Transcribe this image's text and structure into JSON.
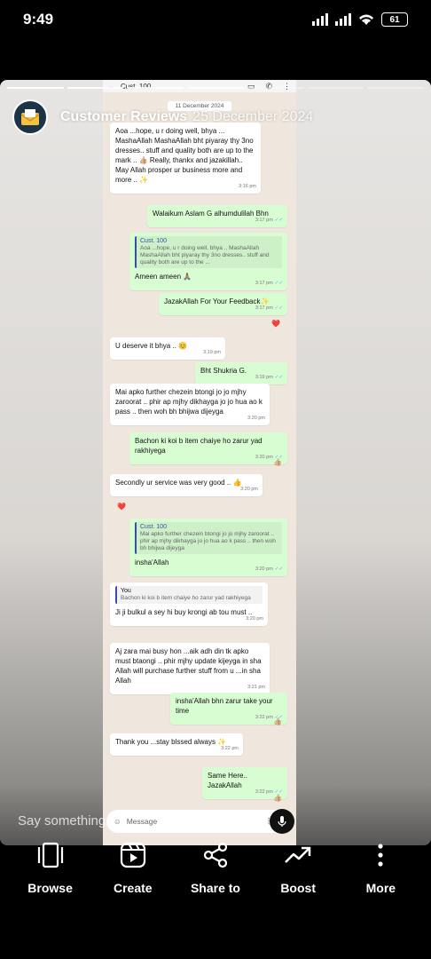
{
  "status_bar": {
    "time": "9:49",
    "battery": "61"
  },
  "story": {
    "title": "Customer Reviews",
    "date": "25 December 2024",
    "reply_placeholder": "Say something..."
  },
  "chat": {
    "contact": "Cust. 100",
    "date_chip": "11 December 2024",
    "input_placeholder": "Message",
    "messages": [
      {
        "dir": "in",
        "text": "Aoa ...hope, u r doing well, bhya ... MashaAllah MashaAllah bht piyaray thy 3no dresses.. stuff and quality both are up to the mark .. 👍🏼 Really, thankx and jazakillah.. May Allah prosper ur business more and more .. ✨",
        "time": "3:16 pm"
      },
      {
        "dir": "out",
        "text": "Walaikum Aslam G alhumdulilah Bhn",
        "time": "3:17 pm"
      },
      {
        "dir": "out",
        "quote_name": "Cust. 100",
        "quote_text": "Aoa ...hope, u r doing well, bhya .. MashaAllah MashaAllah bht piyaray thy 3no dresses.. stuff and quality both are up to the ...",
        "text": "Ameen ameen 🙏🏽",
        "time": "3:17 pm"
      },
      {
        "dir": "out",
        "text": "JazakAllah For Your Feedback✨",
        "time": "3:17 pm",
        "reaction": "❤️"
      },
      {
        "dir": "in",
        "text": "U deserve it bhya .. 😊",
        "time": "3:19 pm"
      },
      {
        "dir": "out",
        "text": "Bht Shukria G.",
        "time": "3:19 pm"
      },
      {
        "dir": "in",
        "text": "Mai apko further chezein btongi jo jo mjhy zaroorat .. phir ap mjhy dikhayga jo jo hua ao k pass .. then woh bh bhijwa dijeyga",
        "time": "3:20 pm"
      },
      {
        "dir": "out",
        "text": "Bachon ki koi b item chaiye ho zarur yad rakhiyega",
        "time": "3:20 pm",
        "reaction": "👍🏼"
      },
      {
        "dir": "in",
        "text": "Secondly ur service was very good .. 👍",
        "time": "3:20 pm",
        "reaction": "❤️"
      },
      {
        "dir": "out",
        "quote_name": "Cust. 100",
        "quote_text": "Mai apko further chezein btongi jo jo mjhy zaroorat .. phir ap mjhy dikhayga jo jo hua ao k pass .. then woh bh bhijwa dijeyga",
        "text": "insha'Allah",
        "time": "3:20 pm"
      },
      {
        "dir": "in",
        "quote_name": "You",
        "quote_text": "Bachon ki koi b item chaiye ho zarur yad rakhiyega",
        "text": "Ji ji bulkul a sey hi buy krongi ab tou must ..",
        "time": "3:20 pm"
      },
      {
        "dir": "in",
        "text": "Aj zara mai busy hon ...aik adh din tk apko must btaongi .. phir mjhy update kijeyga in sha Allah will purchase further stuff from u ...in sha Allah",
        "time": "3:21 pm"
      },
      {
        "dir": "out",
        "text": "insha'Allah bhn zarur take your time",
        "time": "3:22 pm",
        "reaction": "👍🏼"
      },
      {
        "dir": "in",
        "text": "Thank you ...stay blssed always ✨",
        "time": "3:22 pm"
      },
      {
        "dir": "out",
        "text": "Same Here.. JazakAllah",
        "time": "3:22 pm",
        "reaction": "👍🏼"
      }
    ]
  },
  "actions": [
    {
      "label": "Browse",
      "icon": "browse-icon"
    },
    {
      "label": "Create",
      "icon": "create-icon"
    },
    {
      "label": "Share to",
      "icon": "share-icon"
    },
    {
      "label": "Boost",
      "icon": "boost-icon"
    },
    {
      "label": "More",
      "icon": "more-icon"
    }
  ]
}
